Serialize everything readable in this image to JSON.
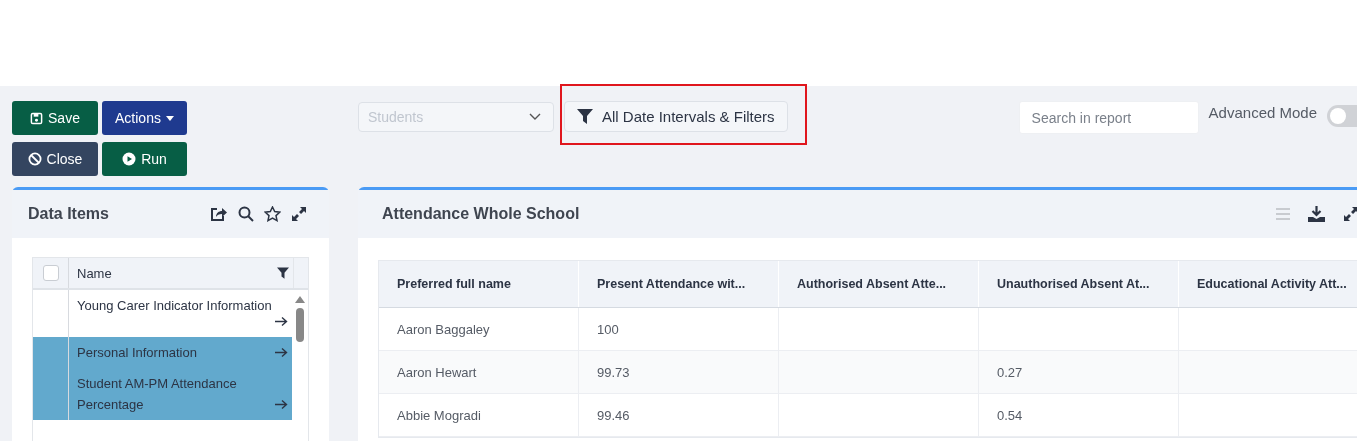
{
  "toolbar": {
    "buttons": [
      {
        "label": "Save",
        "kind": "save"
      },
      {
        "label": "Actions",
        "kind": "actions"
      },
      {
        "label": "Close",
        "kind": "close"
      },
      {
        "label": "Run",
        "kind": "run"
      }
    ],
    "source_select": {
      "placeholder": "Students"
    },
    "filters_button": {
      "label": "All Date Intervals & Filters",
      "highlighted": true
    },
    "search": {
      "placeholder": "Search in report"
    },
    "advanced_mode": {
      "label": "Advanced Mode",
      "on": false
    }
  },
  "data_items": {
    "title": "Data Items",
    "select_all": {
      "checked": false
    },
    "column": "Name",
    "items": [
      {
        "name": "Young Carer Indicator Information",
        "selected": false
      },
      {
        "name": "Personal Information",
        "selected": true
      },
      {
        "name": "Student AM-PM Attendance Percentage",
        "selected": true
      }
    ]
  },
  "report": {
    "title": "Attendance Whole School",
    "columns": [
      "Preferred full name",
      "Present Attendance wit...",
      "Authorised Absent Atte...",
      "Unauthorised Absent At...",
      "Educational Activity Att..."
    ],
    "rows": [
      [
        "Aaron Baggaley",
        "100",
        "",
        "",
        ""
      ],
      [
        "Aaron Hewart",
        "99.73",
        "",
        "0.27",
        ""
      ],
      [
        "Abbie Mogradi",
        "99.46",
        "",
        "0.54",
        ""
      ]
    ]
  }
}
